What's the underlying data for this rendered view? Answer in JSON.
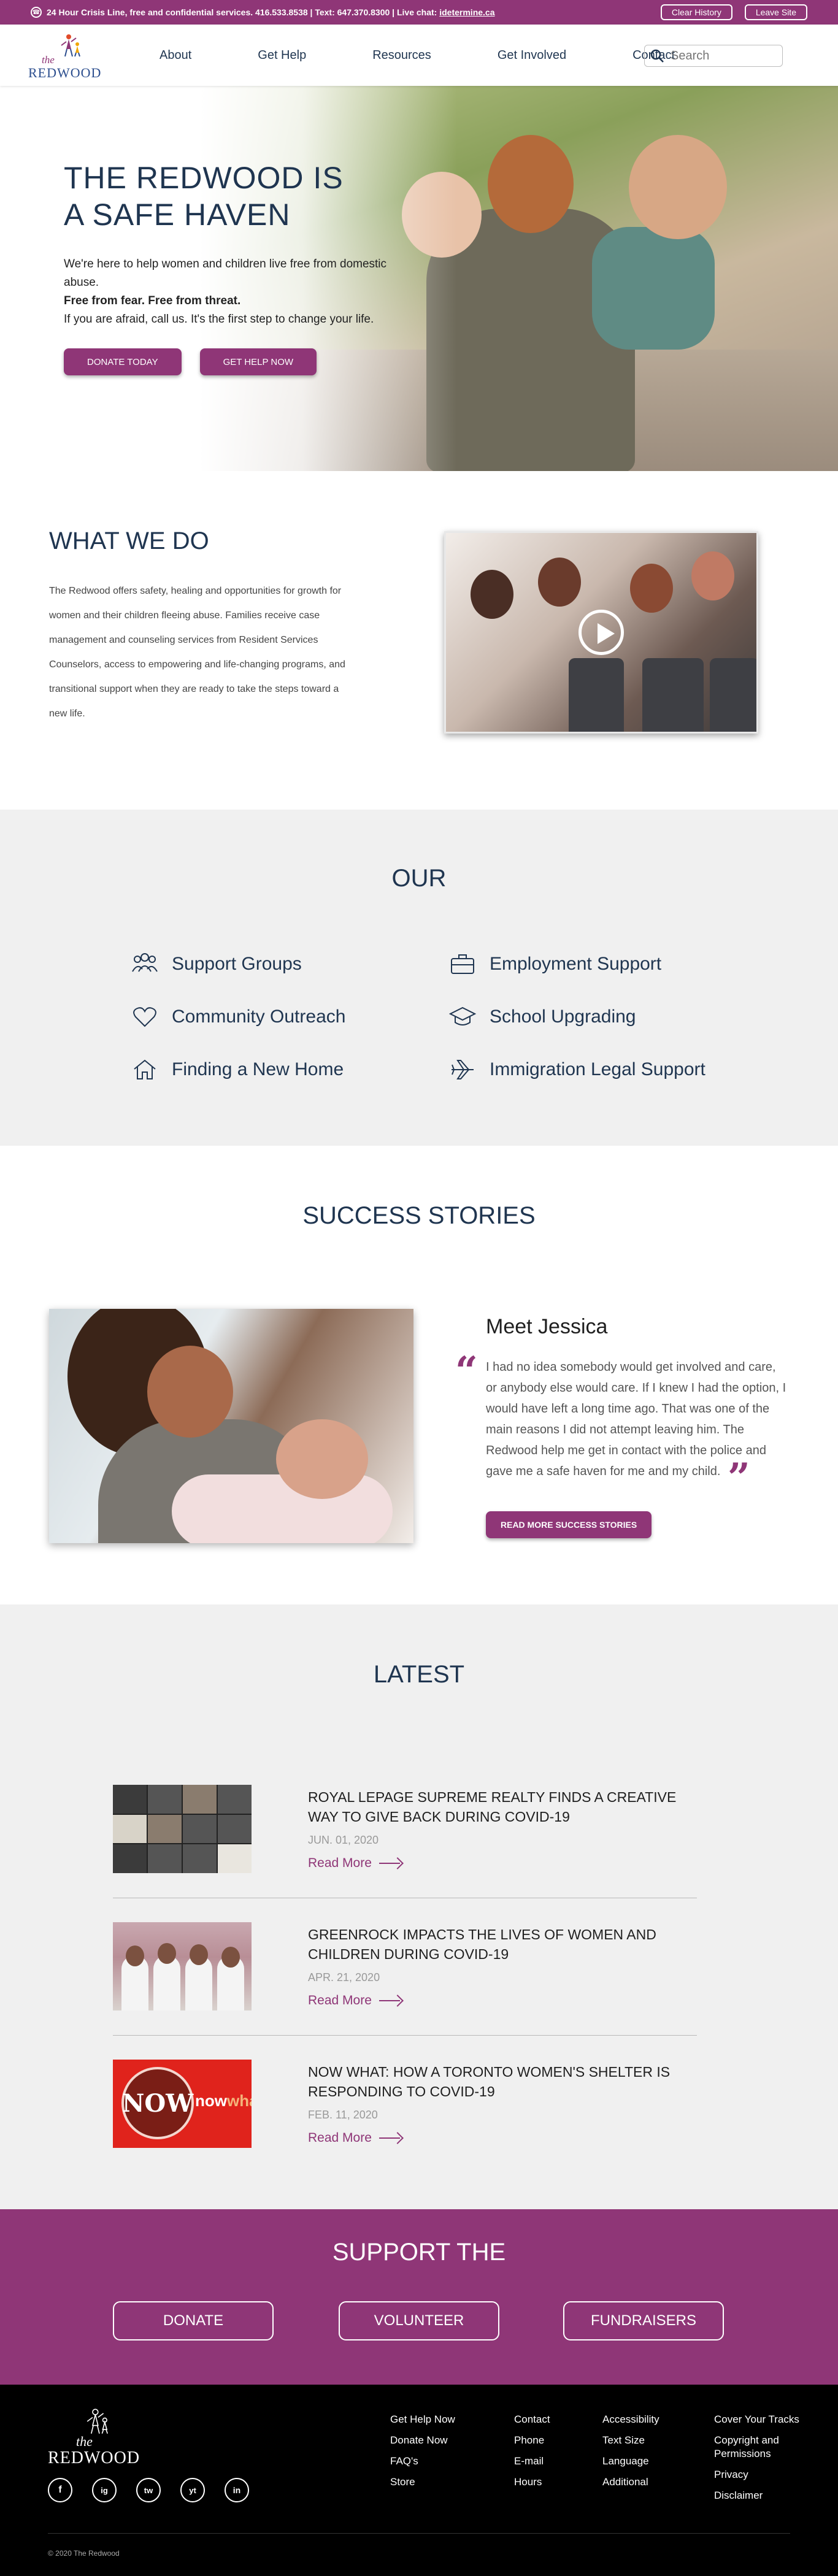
{
  "topbar": {
    "crisis_text": "24 Hour Crisis Line, free and confidential services. 416.533.8538 | Text: 647.370.8300 | Live chat: ",
    "crisis_link": "idetermine.ca",
    "clear_history": "Clear History",
    "leave_site": "Leave Site"
  },
  "header": {
    "logo_the": "the",
    "logo_name": "REDWOOD",
    "nav": [
      "About",
      "Get Help",
      "Resources",
      "Get Involved",
      "Contact"
    ],
    "search_placeholder": "Search"
  },
  "hero": {
    "title_line1": "THE REDWOOD IS",
    "title_line2": "A SAFE HAVEN",
    "desc1": "We're here to help women and children live free from domestic abuse.",
    "desc_strong": "Free from fear. Free from threat.",
    "desc2": "If you are afraid, call us. It's the first step to change your life.",
    "donate_button": "DONATE TODAY",
    "help_button": "GET HELP NOW"
  },
  "what_we_do": {
    "title": "WHAT WE DO",
    "text": "The Redwood offers safety, healing and opportunities for growth for women and their children fleeing abuse. Families receive case management and counseling services from Resident Services Counselors, access to empowering and life-changing programs, and transitional support when they are ready to take the steps toward a new life."
  },
  "our": {
    "title": "OUR",
    "services": [
      {
        "label": "Support Groups",
        "icon": "group-icon"
      },
      {
        "label": "Employment Support",
        "icon": "briefcase-icon"
      },
      {
        "label": "Community Outreach",
        "icon": "heart-icon"
      },
      {
        "label": "School Upgrading",
        "icon": "graduation-cap-icon"
      },
      {
        "label": "Finding a New Home",
        "icon": "home-icon"
      },
      {
        "label": "Immigration Legal Support",
        "icon": "airplane-icon"
      }
    ]
  },
  "success": {
    "title": "SUCCESS STORIES",
    "story_title": "Meet Jessica",
    "quote": "I had no idea somebody would get involved and care, or anybody else would care. If I knew I had the option, I would have left a long time ago. That was one of the main reasons I did not attempt leaving him. The Redwood help me get in contact with the police and gave me a safe haven for me and my child.",
    "button": "READ  MORE SUCCESS STORIES"
  },
  "latest": {
    "title": "LATEST",
    "read_more": "Read More",
    "items": [
      {
        "title": "ROYAL LEPAGE SUPREME REALTY FINDS A CREATIVE WAY TO GIVE BACK DURING COVID-19",
        "date": "JUN. 01, 2020"
      },
      {
        "title": "GREENROCK IMPACTS THE LIVES OF WOMEN AND CHILDREN DURING COVID-19",
        "date": "APR. 21, 2020"
      },
      {
        "title": "NOW WHAT: HOW A TORONTO WOMEN'S SHELTER IS RESPONDING TO COVID-19",
        "date": "FEB. 11, 2020"
      }
    ],
    "now_thumb_circle": "NOW",
    "now_thumb_side_a": "now",
    "now_thumb_side_b": "what"
  },
  "support": {
    "title": "SUPPORT THE",
    "buttons": [
      "DONATE",
      "VOLUNTEER",
      "FUNDRAISERS"
    ]
  },
  "footer": {
    "logo_the": "the",
    "logo_name": "REDWOOD",
    "socials": [
      "f",
      "ig",
      "tw",
      "yt",
      "in"
    ],
    "col1": [
      "Get Help Now",
      "Donate Now",
      "FAQ's",
      "Store"
    ],
    "col2": [
      "Contact",
      "Phone",
      "E-mail",
      "Hours"
    ],
    "col3": [
      "Accessibility",
      "Text Size",
      "Language",
      "Additional"
    ],
    "col4": [
      "Cover Your Tracks",
      "Copyright and Permissions",
      "Privacy",
      "Disclaimer"
    ],
    "copyright": "© 2020 The Redwood"
  },
  "colors": {
    "brand_purple": "#8f3677",
    "navy": "#1f3550",
    "light_gray_bg": "#f0f0f0"
  }
}
